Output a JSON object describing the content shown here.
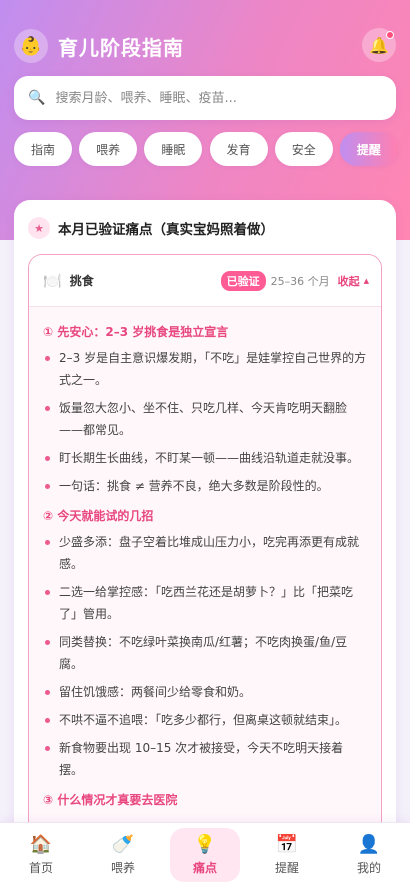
{
  "app": {
    "title": "育儿阶段指南",
    "logo_icon": "👶",
    "bell_icon": "🔔"
  },
  "search": {
    "placeholder": "搜索月龄、喂养、睡眠、疫苗...",
    "icon": "🔍"
  },
  "tabs": [
    {
      "label": "指南",
      "active": false
    },
    {
      "label": "喂养",
      "active": false
    },
    {
      "label": "睡眠",
      "active": false
    },
    {
      "label": "发育",
      "active": false
    },
    {
      "label": "安全",
      "active": false
    },
    {
      "label": "提醒",
      "active": true
    }
  ],
  "card": {
    "icon": "★",
    "title": "本月已验证痛点（真实宝妈照着做）",
    "panel": {
      "icon": "🍽️",
      "name": "挑食",
      "badge": "已验证",
      "age_range": "25–36 个月",
      "collapse_label": "收起",
      "caret": "▲",
      "sections": [
        {
          "heading": "① 先安心：2–3 岁挑食是独立宣言",
          "bullets": [
            "2–3 岁是自主意识爆发期，「不吃」是娃掌控自己世界的方式之一。",
            "饭量忽大忽小、坐不住、只吃几样、今天肯吃明天翻脸——都常见。",
            "盯长期生长曲线，不盯某一顿——曲线沿轨道走就没事。",
            "一句话：挑食 ≠ 营养不良，绝大多数是阶段性的。"
          ]
        },
        {
          "heading": "② 今天就能试的几招",
          "bullets": [
            "少盛多添：盘子空着比堆成山压力小，吃完再添更有成就感。",
            "二选一给掌控感：「吃西兰花还是胡萝卜？」比「把菜吃了」管用。",
            "同类替换：不吃绿叶菜换南瓜/红薯；不吃肉换蛋/鱼/豆腐。",
            "留住饥饿感：两餐间少给零食和奶。",
            "不哄不逼不追喂：「吃多少都行，但离桌这顿就结束」。",
            "新食物要出现 10–15 次才被接受，今天不吃明天接着摆。"
          ]
        },
        {
          "heading": "③ 什么情况才真要去医院",
          "bullets": []
        }
      ]
    }
  },
  "bottom_nav": [
    {
      "label": "首页",
      "icon": "🏠",
      "active": false
    },
    {
      "label": "喂养",
      "icon": "🍼",
      "active": false
    },
    {
      "label": "痛点",
      "icon": "💡",
      "active": true
    },
    {
      "label": "提醒",
      "icon": "📅",
      "active": false
    },
    {
      "label": "我的",
      "icon": "👤",
      "active": false
    }
  ]
}
